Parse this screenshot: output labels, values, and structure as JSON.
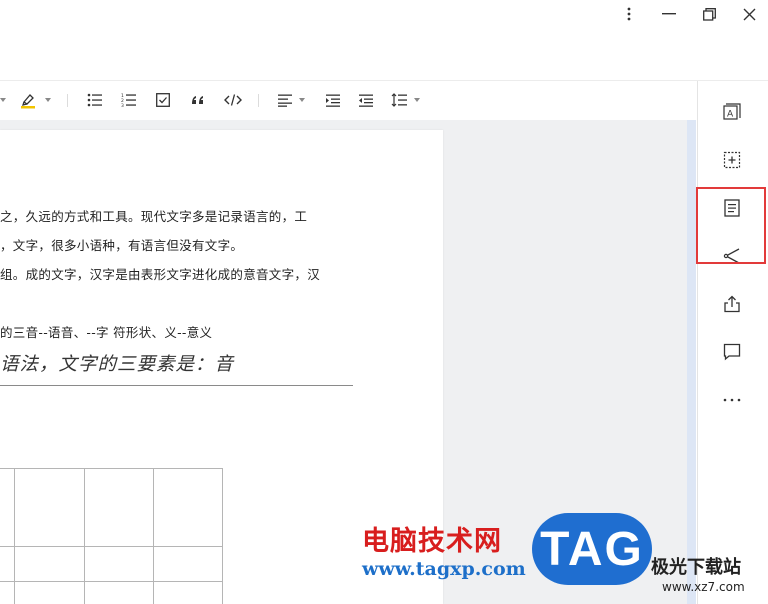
{
  "document": {
    "lines": [
      "之，久远的方式和工具。现代文字多是记录语言的，工",
      "，文字，很多小语种，有语言但没有文字。",
      "组。成的文字，汉字是由表形文字进化成的意音文字，汉",
      "的三音--语音、--字  符形状、义--意义"
    ],
    "heading": "语法，文字的三要素是：音"
  },
  "toolbar_icons": [
    "highlight-pen-icon",
    "dropdown-caret-icon",
    "bullet-list-icon",
    "numbered-list-icon",
    "checklist-icon",
    "quote-icon",
    "code-icon",
    "align-left-icon",
    "indent-icon",
    "outdent-icon",
    "line-spacing-icon"
  ],
  "sidebar_icons": [
    "text-box-icon",
    "add-frame-icon",
    "outline-document-icon",
    "share-icon",
    "export-icon",
    "comment-icon",
    "more-icon"
  ],
  "watermark": {
    "brand_cn": "电脑技术网",
    "brand_url": "www.tagxp.com",
    "tag": "TAG",
    "site_cn": "极光下载站",
    "site_url": "www.xz7.com"
  },
  "colors": {
    "highlight_box": "#e23a3a",
    "watermark_red": "#d81e1e",
    "watermark_blue": "#1f6ed0",
    "highlighter_yellow": "#f2c400"
  }
}
